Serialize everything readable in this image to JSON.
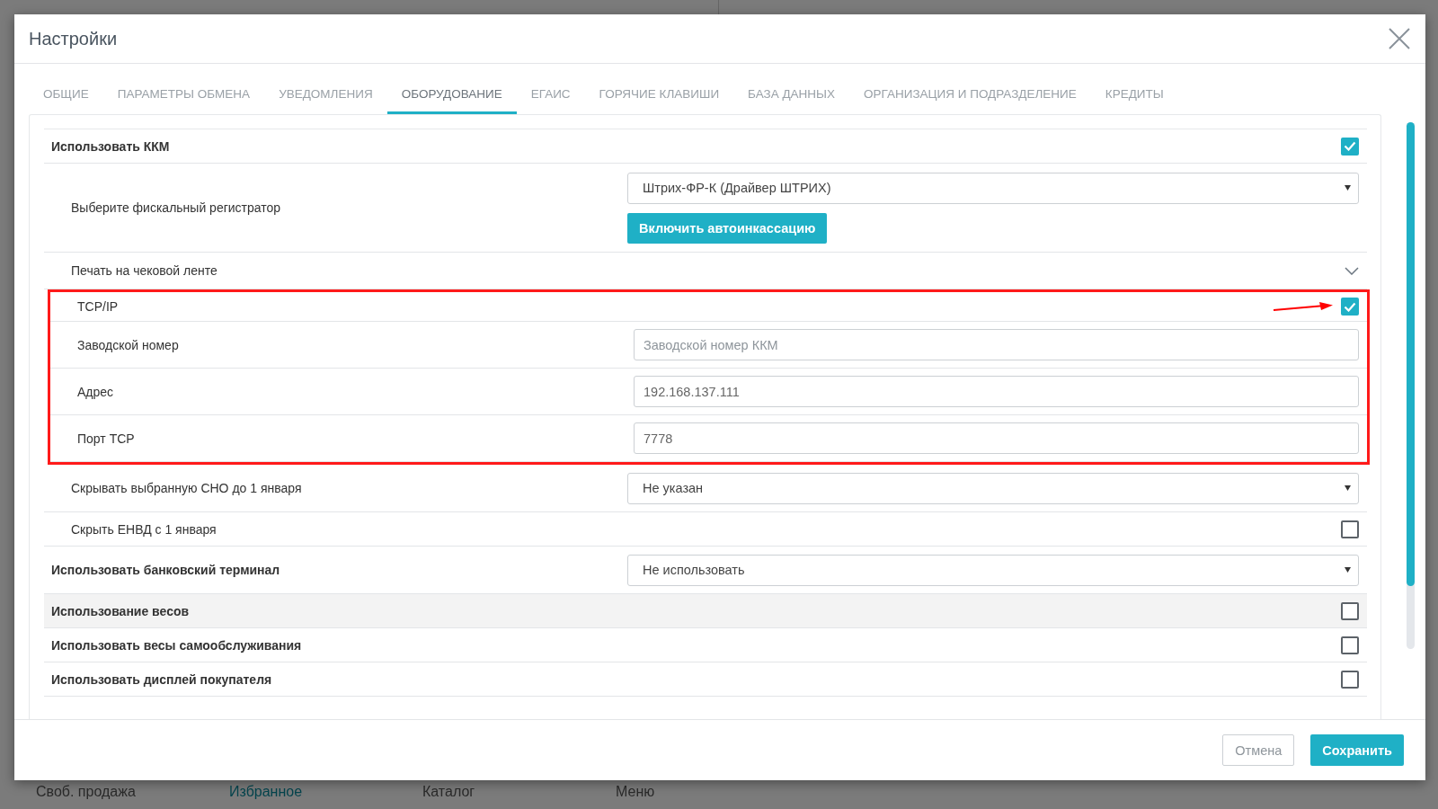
{
  "background_nav": [
    {
      "label": "Своб. продажа",
      "selected": false
    },
    {
      "label": "Избранное",
      "selected": true
    },
    {
      "label": "Каталог",
      "selected": false
    },
    {
      "label": "Меню",
      "selected": false
    }
  ],
  "dialog": {
    "title": "Настройки"
  },
  "tabs": [
    {
      "label": "ОБЩИЕ",
      "selected": false
    },
    {
      "label": "ПАРАМЕТРЫ ОБМЕНА",
      "selected": false
    },
    {
      "label": "УВЕДОМЛЕНИЯ",
      "selected": false
    },
    {
      "label": "ОБОРУДОВАНИЕ",
      "selected": true
    },
    {
      "label": "ЕГАИС",
      "selected": false
    },
    {
      "label": "ГОРЯЧИЕ КЛАВИШИ",
      "selected": false
    },
    {
      "label": "БАЗА ДАННЫХ",
      "selected": false
    },
    {
      "label": "ОРГАНИЗАЦИЯ И ПОДРАЗДЕЛЕНИЕ",
      "selected": false
    },
    {
      "label": "КРЕДИТЫ",
      "selected": false
    }
  ],
  "rows": [
    {
      "kind": "check",
      "label": "Использовать ККМ",
      "checked": true,
      "hovered": false,
      "children": [
        {
          "kind": "fiscal",
          "label": "Выберите фискальный регистратор",
          "value": "Штрих-ФР-К (Драйвер ШТРИХ)",
          "button": "Включить автоинкассацию",
          "highlighted": false
        },
        {
          "kind": "expand",
          "label": "Печать на чековой ленте",
          "expanded": false,
          "highlighted": false
        },
        {
          "kind": "check",
          "label": "TCP/IP",
          "checked": true,
          "highlighted": true,
          "arrow": true
        },
        {
          "kind": "input",
          "label": "Заводской номер",
          "placeholder": "Заводской номер ККМ",
          "highlighted": true
        },
        {
          "kind": "input",
          "label": "Адрес",
          "value": "192.168.137.111",
          "highlighted": true
        },
        {
          "kind": "input",
          "label": "Порт TCP",
          "value": "7778",
          "highlighted": true
        },
        {
          "kind": "select",
          "label": "Скрывать выбранную СНО до 1 января",
          "value": "Не указан",
          "highlighted": false
        },
        {
          "kind": "check",
          "label": "Скрыть ЕНВД с 1 января",
          "checked": false,
          "highlighted": false
        }
      ]
    },
    {
      "kind": "select",
      "label": "Использовать банковский терминал",
      "value": "Не использовать",
      "hovered": false
    },
    {
      "kind": "check",
      "label": "Использование весов",
      "checked": false,
      "hovered": true
    },
    {
      "kind": "check",
      "label": "Использовать весы самообслуживания",
      "checked": false,
      "hovered": false
    },
    {
      "kind": "check",
      "label": "Использовать дисплей покупателя",
      "checked": false,
      "hovered": false
    }
  ],
  "footer": {
    "cancel": "Отмена",
    "save": "Сохранить"
  }
}
